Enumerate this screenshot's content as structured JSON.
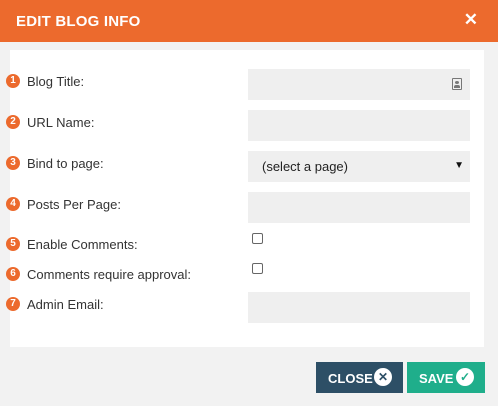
{
  "dialog": {
    "title": "EDIT BLOG INFO",
    "close_icon": "close-x-icon"
  },
  "fields": [
    {
      "number": "1",
      "label": "Blog Title:",
      "type": "text",
      "value": "",
      "icon": "contact-card-icon"
    },
    {
      "number": "2",
      "label": "URL Name:",
      "type": "text",
      "value": ""
    },
    {
      "number": "3",
      "label": "Bind to page:",
      "type": "select",
      "value": "(select a page)"
    },
    {
      "number": "4",
      "label": "Posts Per Page:",
      "type": "text",
      "value": ""
    },
    {
      "number": "5",
      "label": "Enable Comments:",
      "type": "checkbox",
      "checked": false
    },
    {
      "number": "6",
      "label": "Comments require approval:",
      "type": "checkbox",
      "checked": false
    },
    {
      "number": "7",
      "label": "Admin Email:",
      "type": "text",
      "value": ""
    }
  ],
  "footer": {
    "close_label": "CLOSE",
    "save_label": "SAVE"
  },
  "colors": {
    "header": "#ec6a2d",
    "close_button": "#2d4f66",
    "save_button": "#1fae8b"
  }
}
